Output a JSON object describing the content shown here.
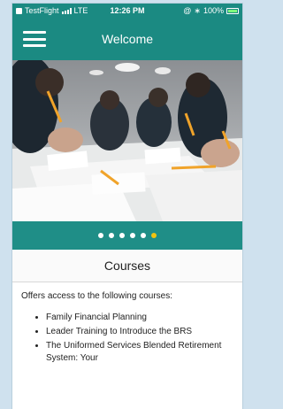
{
  "status_bar": {
    "carrier": "TestFlight",
    "network": "LTE",
    "time": "12:26 PM",
    "battery": "100%"
  },
  "nav": {
    "title": "Welcome",
    "menu_icon": "hamburger-menu-icon"
  },
  "carousel": {
    "slide_count": 6,
    "active_index": 5,
    "hero_description": "classroom"
  },
  "courses": {
    "title": "Courses",
    "description": "Offers access to the following courses:",
    "items": [
      "Family Financial Planning",
      "Leader Training to Introduce the BRS",
      "The Uniformed Services Blended Retirement System: Your"
    ]
  },
  "colors": {
    "primary": "#1b8a82",
    "dot_active": "#f1c40f",
    "dot_inactive": "#ffffff"
  }
}
